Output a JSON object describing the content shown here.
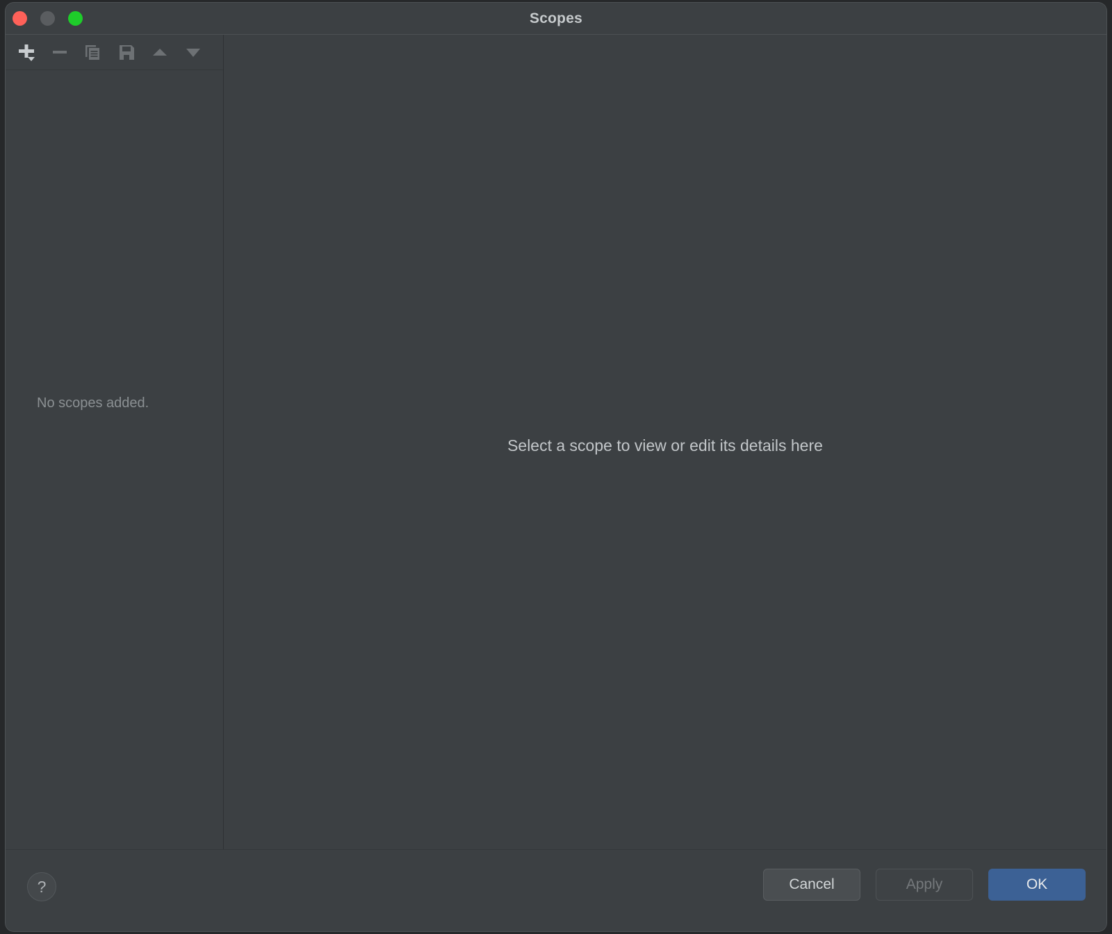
{
  "window": {
    "title": "Scopes",
    "traffic_lights": [
      {
        "name": "close",
        "color": "#ff6159"
      },
      {
        "name": "minimize",
        "color": "#5a5d60"
      },
      {
        "name": "zoom",
        "color": "#1ecd2a"
      }
    ],
    "background_color": "#3c4043"
  },
  "toolbar": {
    "buttons": [
      {
        "icon": "add-icon",
        "label": "Add",
        "has_dropdown": true,
        "enabled": true
      },
      {
        "icon": "remove-icon",
        "label": "Remove",
        "has_dropdown": false,
        "enabled": false
      },
      {
        "icon": "copy-icon",
        "label": "Duplicate",
        "has_dropdown": false,
        "enabled": false
      },
      {
        "icon": "save-icon",
        "label": "Save",
        "has_dropdown": false,
        "enabled": false
      },
      {
        "icon": "move-up-icon",
        "label": "Move Up",
        "has_dropdown": false,
        "enabled": false
      },
      {
        "icon": "move-down-icon",
        "label": "Move Down",
        "has_dropdown": false,
        "enabled": false
      }
    ]
  },
  "left_pane": {
    "empty_message": "No scopes added.",
    "items": []
  },
  "right_pane": {
    "placeholder": "Select a scope to view or edit its details here"
  },
  "footer": {
    "help_glyph": "?",
    "buttons": {
      "cancel": "Cancel",
      "apply": "Apply",
      "ok": "OK"
    },
    "accent_color": "#3c6195"
  }
}
